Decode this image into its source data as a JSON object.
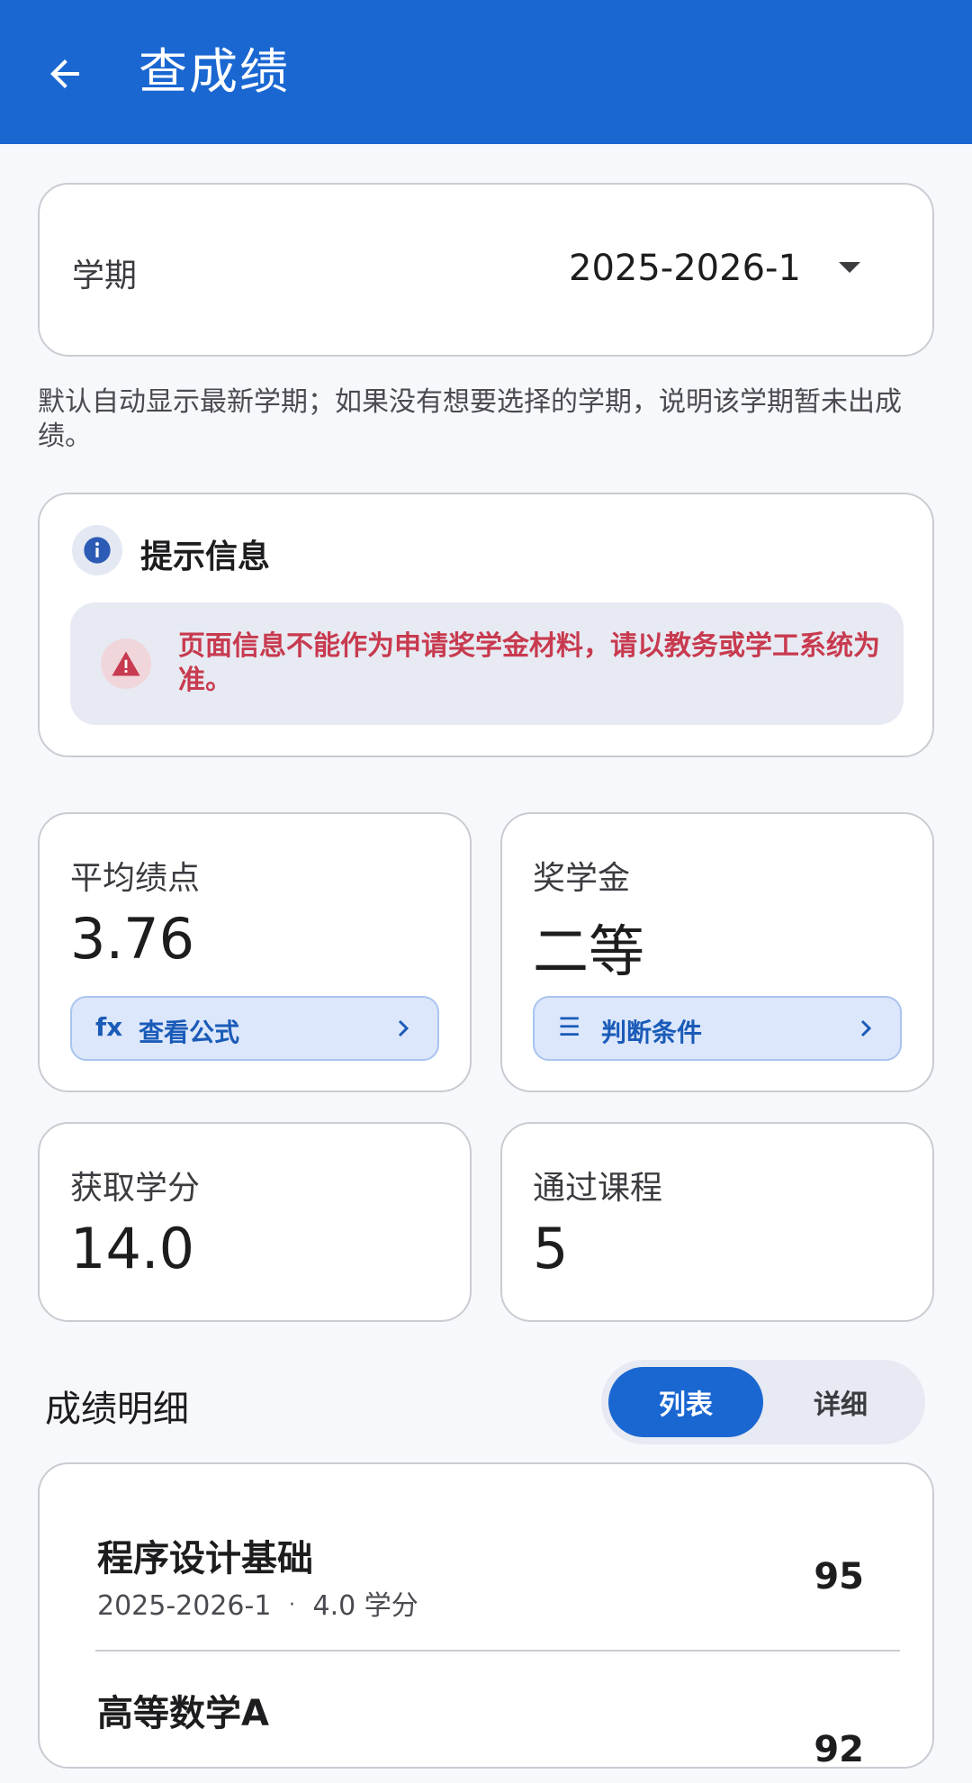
{
  "appbar": {
    "title": "查成绩",
    "back_icon": "arrow-left-icon"
  },
  "term": {
    "label": "学期",
    "value": "2025-2026-1"
  },
  "hint": "默认自动显示最新学期；如果没有想要选择的学期，说明该学期暂未出成绩。",
  "notice": {
    "title": "提示信息",
    "warning": "页面信息不能作为申请奖学金材料，请以教务或学工系统为准。"
  },
  "stats": {
    "gpa": {
      "label": "平均绩点",
      "value": "3.76",
      "chip_icon": "fx",
      "chip_label": "查看公式"
    },
    "scholarship": {
      "label": "奖学金",
      "value": "二等",
      "chip_icon": "☰",
      "chip_label": "判断条件"
    },
    "credits": {
      "label": "获取学分",
      "value": "14.0"
    },
    "courses": {
      "label": "通过课程",
      "value": "5"
    }
  },
  "details": {
    "title": "成绩明细",
    "toggle": {
      "list": "列表",
      "detail": "详细",
      "selected": "列表"
    },
    "rows": [
      {
        "name": "程序设计基础",
        "term": "2025-2026-1",
        "sep": "·",
        "credits": "4.0 学分",
        "score": "95"
      },
      {
        "name": "高等数学A",
        "score": "92"
      }
    ]
  },
  "colors": {
    "primary": "#1a67d2",
    "warning": "#c83a4f",
    "chip_bg": "#dce7fb"
  }
}
